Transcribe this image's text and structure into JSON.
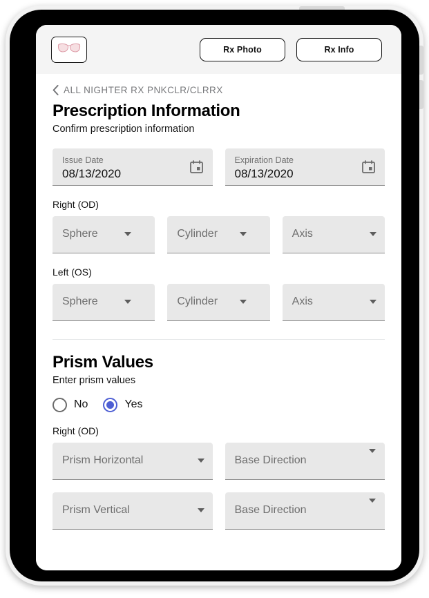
{
  "header": {
    "product_thumb_icon": "eyeglasses-icon",
    "buttons": [
      {
        "label": "Rx Photo",
        "name": "rx-photo-button"
      },
      {
        "label": "Rx Info",
        "name": "rx-info-button"
      }
    ]
  },
  "breadcrumb": {
    "back_icon": "chevron-left-icon",
    "text": "ALL NIGHTER RX  PNKCLR/CLRRX"
  },
  "prescription": {
    "title": "Prescription Information",
    "subtitle": "Confirm prescription information",
    "issue_date": {
      "label": "Issue Date",
      "value": "08/13/2020",
      "icon": "calendar-icon"
    },
    "expiration_date": {
      "label": "Expiration Date",
      "value": "08/13/2020",
      "icon": "calendar-icon"
    },
    "right_eye_label": "Right (OD)",
    "left_eye_label": "Left (OS)",
    "right_fields": [
      {
        "placeholder": "Sphere"
      },
      {
        "placeholder": "Cylinder"
      },
      {
        "placeholder": "Axis"
      }
    ],
    "left_fields": [
      {
        "placeholder": "Sphere"
      },
      {
        "placeholder": "Cylinder"
      },
      {
        "placeholder": "Axis"
      }
    ]
  },
  "prism": {
    "title": "Prism Values",
    "subtitle": "Enter prism values",
    "options": [
      {
        "label": "No",
        "selected": false
      },
      {
        "label": "Yes",
        "selected": true
      }
    ],
    "right_eye_label": "Right (OD)",
    "rows": [
      {
        "amount_placeholder": "Prism Horizontal",
        "direction_placeholder": "Base Direction"
      },
      {
        "amount_placeholder": "Prism Vertical",
        "direction_placeholder": "Base Direction"
      }
    ]
  },
  "colors": {
    "accent": "#4e5fd4",
    "field_bg": "#e8e8e8",
    "header_bg": "#f4f4f4",
    "frame": "#000000",
    "placeholder_text": "#6f6f6f"
  }
}
